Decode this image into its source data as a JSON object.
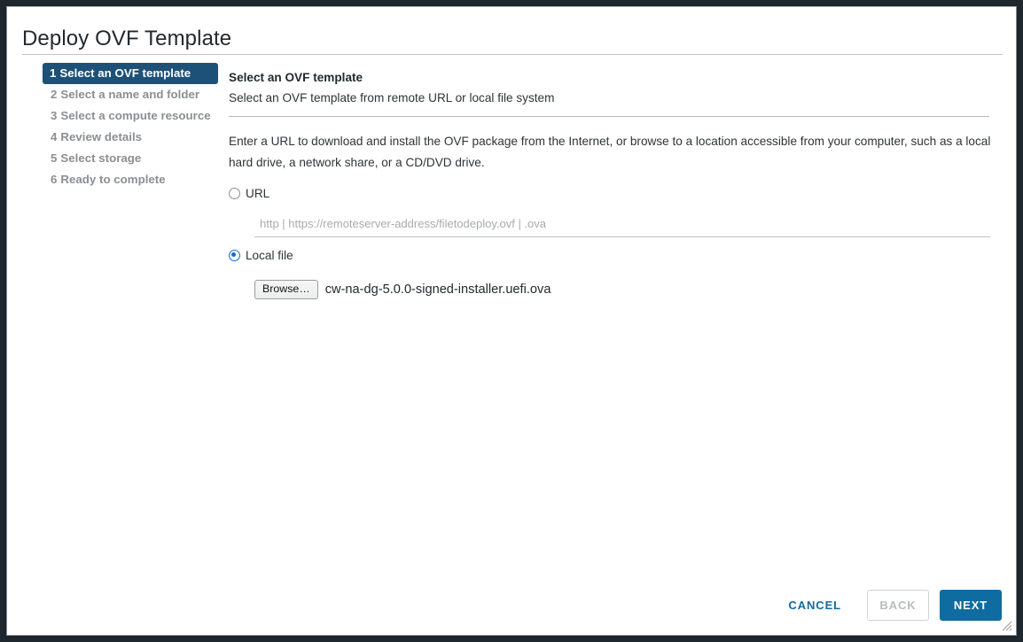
{
  "dialog": {
    "title": "Deploy OVF Template"
  },
  "steps": [
    {
      "num": "1",
      "label": "Select an OVF template",
      "state": "active"
    },
    {
      "num": "2",
      "label": "Select a name and folder",
      "state": "pending"
    },
    {
      "num": "3",
      "label": "Select a compute resource",
      "state": "pending"
    },
    {
      "num": "4",
      "label": "Review details",
      "state": "pending"
    },
    {
      "num": "5",
      "label": "Select storage",
      "state": "pending"
    },
    {
      "num": "6",
      "label": "Ready to complete",
      "state": "pending"
    }
  ],
  "content": {
    "heading": "Select an OVF template",
    "subheading": "Select an OVF template from remote URL or local file system",
    "intro_line1": "Enter a URL to download and install the OVF package from the Internet, or browse to a location accessible from your computer, such as",
    "intro_line2": "a local hard drive, a network share, or a CD/DVD drive.",
    "url_option_label": "URL",
    "url_input_value": "",
    "url_input_placeholder": "http | https://remoteserver-address/filetodeploy.ovf | .ova",
    "local_file_option_label": "Local file",
    "browse_button_label": "Browse…",
    "selected_filename": "cw-na-dg-5.0.0-signed-installer.uefi.ova",
    "selected_source": "local-file"
  },
  "footer": {
    "cancel_label": "CANCEL",
    "back_label": "BACK",
    "next_label": "NEXT"
  },
  "icons": {
    "resize_grip": "resize-grip-icon",
    "url_radio": "radio-unchecked-icon",
    "local_file_radio": "radio-checked-icon"
  },
  "colors": {
    "active_step_bg": "#1e5178",
    "primary_button_bg": "#0e6ca0",
    "link_text": "#0f6ca0",
    "radio_accent": "#1669d6",
    "app_chrome_dark": "#1f282e"
  }
}
